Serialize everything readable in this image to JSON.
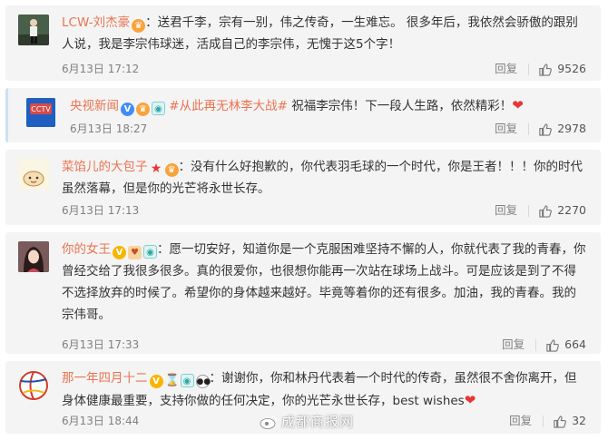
{
  "comments": [
    {
      "name": "LCW-刘杰豪",
      "badges": [
        "crown-badge"
      ],
      "topic": "",
      "text": "：送君千李，宗有一别，伟之传奇，一生难忘。 很多年后，我依然会骄傲的跟别人说，我是李宗伟球迷，活成自己的李宗伟，无愧于这5个字！",
      "time": "6月13日 17:12",
      "reply": "回复",
      "likes": "9526",
      "avatar_icon": "runner-avatar-icon"
    },
    {
      "name": "央视新闻",
      "badges": [
        "verified-badge",
        "crown-badge",
        "fans-badge"
      ],
      "topic": "#从此再无林李大战#",
      "text": " 祝福李宗伟！下一段人生路，依然精彩！",
      "time": "6月13日 18:27",
      "reply": "回复",
      "likes": "2978",
      "avatar_icon": "cctv-news-logo-icon",
      "avatar_text": "央视新闻"
    },
    {
      "name": "菜馅儿的大包子",
      "badges": [
        "star-badge",
        "crown-badge"
      ],
      "topic": "",
      "text": "：没有什么好抱歉的，你代表羽毛球的一个时代，你是王者！！！你的时代虽然落幕，但是你的光芒将永世长存。",
      "time": "6月13日 17:13",
      "reply": "回复",
      "likes": "2270",
      "avatar_icon": "bun-avatar-icon",
      "avatar_text": "包贝贝"
    },
    {
      "name": "你的女王",
      "badges": [
        "vip-yellow-badge",
        "heart-fans-badge",
        "fans-badge"
      ],
      "topic": "",
      "text": "：愿一切安好，知道你是一个克服困难坚持不懈的人，你就代表了我的青春，你曾经交给了我很多很多。真的很爱你，也很想你能再一次站在球场上战斗。可是应该是到了不得不选择放弃的时候了。希望你的身体越来越好。毕竟等着你的还有很多。加油，我的青春。我的宗伟哥。",
      "time": "6月13日 17:33",
      "reply": "回复",
      "likes": "664",
      "avatar_icon": "woman-avatar-icon"
    },
    {
      "name": "那一年四月十二",
      "badges": [
        "vip-yellow-badge",
        "hourglass-badge",
        "fans-badge",
        "panda-badge"
      ],
      "topic": "",
      "text": "：谢谢你，你和林丹代表着一个时代的传奇，虽然很不舍你离开，但身体健康最重要，支持你做的任何决定，你的光芒永世长存，best wishes",
      "time": "6月13日 18:44",
      "reply": "回复",
      "likes": "32",
      "avatar_icon": "volleyball-avatar-icon"
    }
  ],
  "watermark": "成都商报网"
}
